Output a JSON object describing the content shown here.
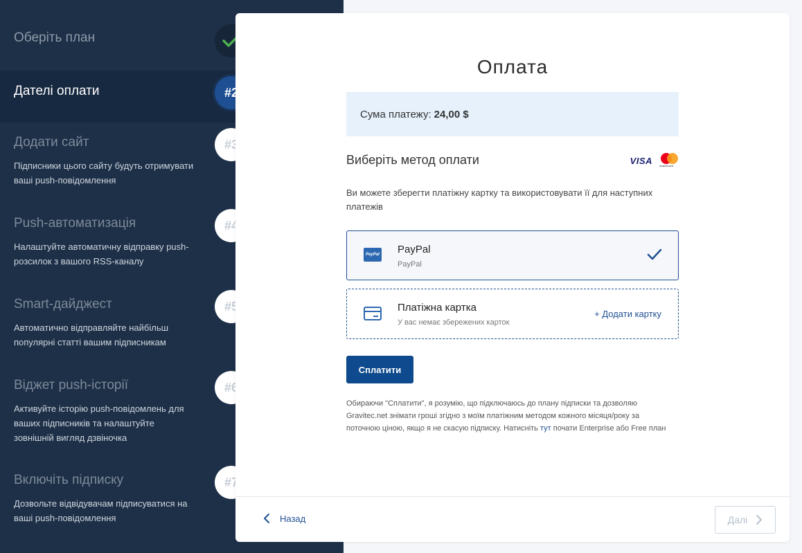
{
  "sidebar": {
    "steps": [
      {
        "title": "Оберіть план",
        "description": "",
        "badge": ""
      },
      {
        "title": "Дателі оплати",
        "description": "",
        "badge": "#2"
      },
      {
        "title": "Додати сайт",
        "description": "Підписники цього сайту будуть отримувати ваші push-повідомлення",
        "badge": "#3"
      },
      {
        "title": "Push-автоматизація",
        "description": "Налаштуйте автоматичну відправку push-розсилок з вашого RSS-каналу",
        "badge": "#4"
      },
      {
        "title": "Smart-дайджест",
        "description": "Автоматично відправляйте найбільш популярні статті вашим підписникам",
        "badge": "#5"
      },
      {
        "title": "Віджет push-історії",
        "description": "Активуйте історію push-повідомлень для ваших підписників та налаштуйте зовнішній вигляд дзвіночка",
        "badge": "#6"
      },
      {
        "title": "Включіть підписку",
        "description": "Дозвольте відвідувачам підписуватися на ваші push-повідомлення",
        "badge": "#7"
      }
    ]
  },
  "main": {
    "title": "Оплата",
    "amount_label": "Сума платежу:",
    "amount_value": "24,00 $",
    "method_title": "Виберіть метод оплати",
    "visa_text": "VISA",
    "mastercard_text": "mastercard",
    "hint": "Ви можете зберегти платіжну картку та використовувати її для наступних платежів",
    "options": [
      {
        "name": "PayPal",
        "sub": "PayPal",
        "icon_text": "PayPal"
      },
      {
        "name": "Платіжна картка",
        "sub": "У вас немає збережених карток",
        "action": "+ Додати картку"
      }
    ],
    "pay_button": "Сплатити",
    "terms_before": "Обираючи \"Сплатити\", я розумію, що підключаюсь до плану підписки та дозволяю Gravitec.net знімати гроші згідно з моїм платіжним методом кожного місяця/року за поточною ціною, якщо я не скасую підписку. Натисніть ",
    "terms_link": "тут",
    "terms_after": " почати Enterprise або Free план"
  },
  "footer": {
    "back": "Назад",
    "next": "Далі"
  },
  "colors": {
    "sidebar_bg": "#1d3048",
    "accent": "#1e4f93",
    "success": "#4caf50",
    "amount_bg": "#e6f1fc"
  }
}
